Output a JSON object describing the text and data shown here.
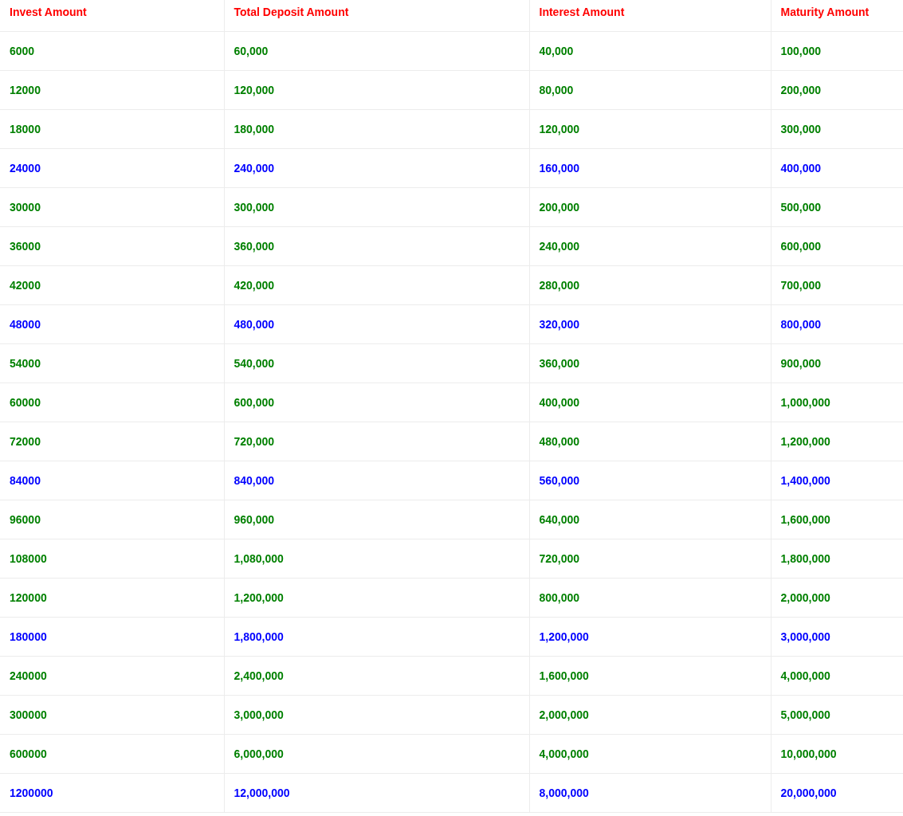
{
  "table": {
    "columns": [
      "Invest Amount",
      "Total Deposit Amount",
      "Interest Amount",
      "Maturity Amount"
    ],
    "rows": [
      {
        "color": "#008000",
        "cells": [
          "6000",
          "60,000",
          "40,000",
          "100,000"
        ]
      },
      {
        "color": "#008000",
        "cells": [
          "12000",
          "120,000",
          "80,000",
          "200,000"
        ]
      },
      {
        "color": "#008000",
        "cells": [
          "18000",
          "180,000",
          "120,000",
          "300,000"
        ]
      },
      {
        "color": "#0000ff",
        "cells": [
          "24000",
          "240,000",
          "160,000",
          "400,000"
        ]
      },
      {
        "color": "#008000",
        "cells": [
          "30000",
          "300,000",
          "200,000",
          "500,000"
        ]
      },
      {
        "color": "#008000",
        "cells": [
          "36000",
          "360,000",
          "240,000",
          "600,000"
        ]
      },
      {
        "color": "#008000",
        "cells": [
          "42000",
          "420,000",
          "280,000",
          "700,000"
        ]
      },
      {
        "color": "#0000ff",
        "cells": [
          "48000",
          "480,000",
          "320,000",
          "800,000"
        ]
      },
      {
        "color": "#008000",
        "cells": [
          "54000",
          "540,000",
          "360,000",
          "900,000"
        ]
      },
      {
        "color": "#008000",
        "cells": [
          "60000",
          "600,000",
          "400,000",
          "1,000,000"
        ]
      },
      {
        "color": "#008000",
        "cells": [
          "72000",
          "720,000",
          "480,000",
          "1,200,000"
        ]
      },
      {
        "color": "#0000ff",
        "cells": [
          "84000",
          "840,000",
          "560,000",
          "1,400,000"
        ]
      },
      {
        "color": "#008000",
        "cells": [
          "96000",
          "960,000",
          "640,000",
          "1,600,000"
        ]
      },
      {
        "color": "#008000",
        "cells": [
          "108000",
          "1,080,000",
          "720,000",
          "1,800,000"
        ]
      },
      {
        "color": "#008000",
        "cells": [
          "120000",
          "1,200,000",
          "800,000",
          "2,000,000"
        ]
      },
      {
        "color": "#0000ff",
        "cells": [
          "180000",
          "1,800,000",
          "1,200,000",
          "3,000,000"
        ]
      },
      {
        "color": "#008000",
        "cells": [
          "240000",
          "2,400,000",
          "1,600,000",
          "4,000,000"
        ]
      },
      {
        "color": "#008000",
        "cells": [
          "300000",
          "3,000,000",
          "2,000,000",
          "5,000,000"
        ]
      },
      {
        "color": "#008000",
        "cells": [
          "600000",
          "6,000,000",
          "4,000,000",
          "10,000,000"
        ]
      },
      {
        "color": "#0000ff",
        "cells": [
          "1200000",
          "12,000,000",
          "8,000,000",
          "20,000,000"
        ]
      }
    ]
  }
}
